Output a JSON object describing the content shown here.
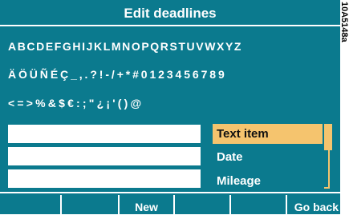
{
  "title": "Edit deadlines",
  "charset_rows": [
    "ABCDEFGHIJKLMNOPQRSTUVWXYZ",
    "ÄÖÜÑÉÇ_,.?!-/+*#0123456789",
    "<=>%&$€:;\"¿¡'()@"
  ],
  "input_fields": [
    "",
    "",
    ""
  ],
  "options": [
    {
      "label": "Text item",
      "selected": true
    },
    {
      "label": "Date",
      "selected": false
    },
    {
      "label": "Mileage",
      "selected": false
    }
  ],
  "softkeys": [
    "",
    "",
    "New",
    "",
    "",
    "Go back"
  ],
  "reference_code": "10A5148a",
  "colors": {
    "screen_bg": "#0b7a8e",
    "highlight": "#f5c46e",
    "text": "#ffffff",
    "field_bg": "#ffffff"
  }
}
